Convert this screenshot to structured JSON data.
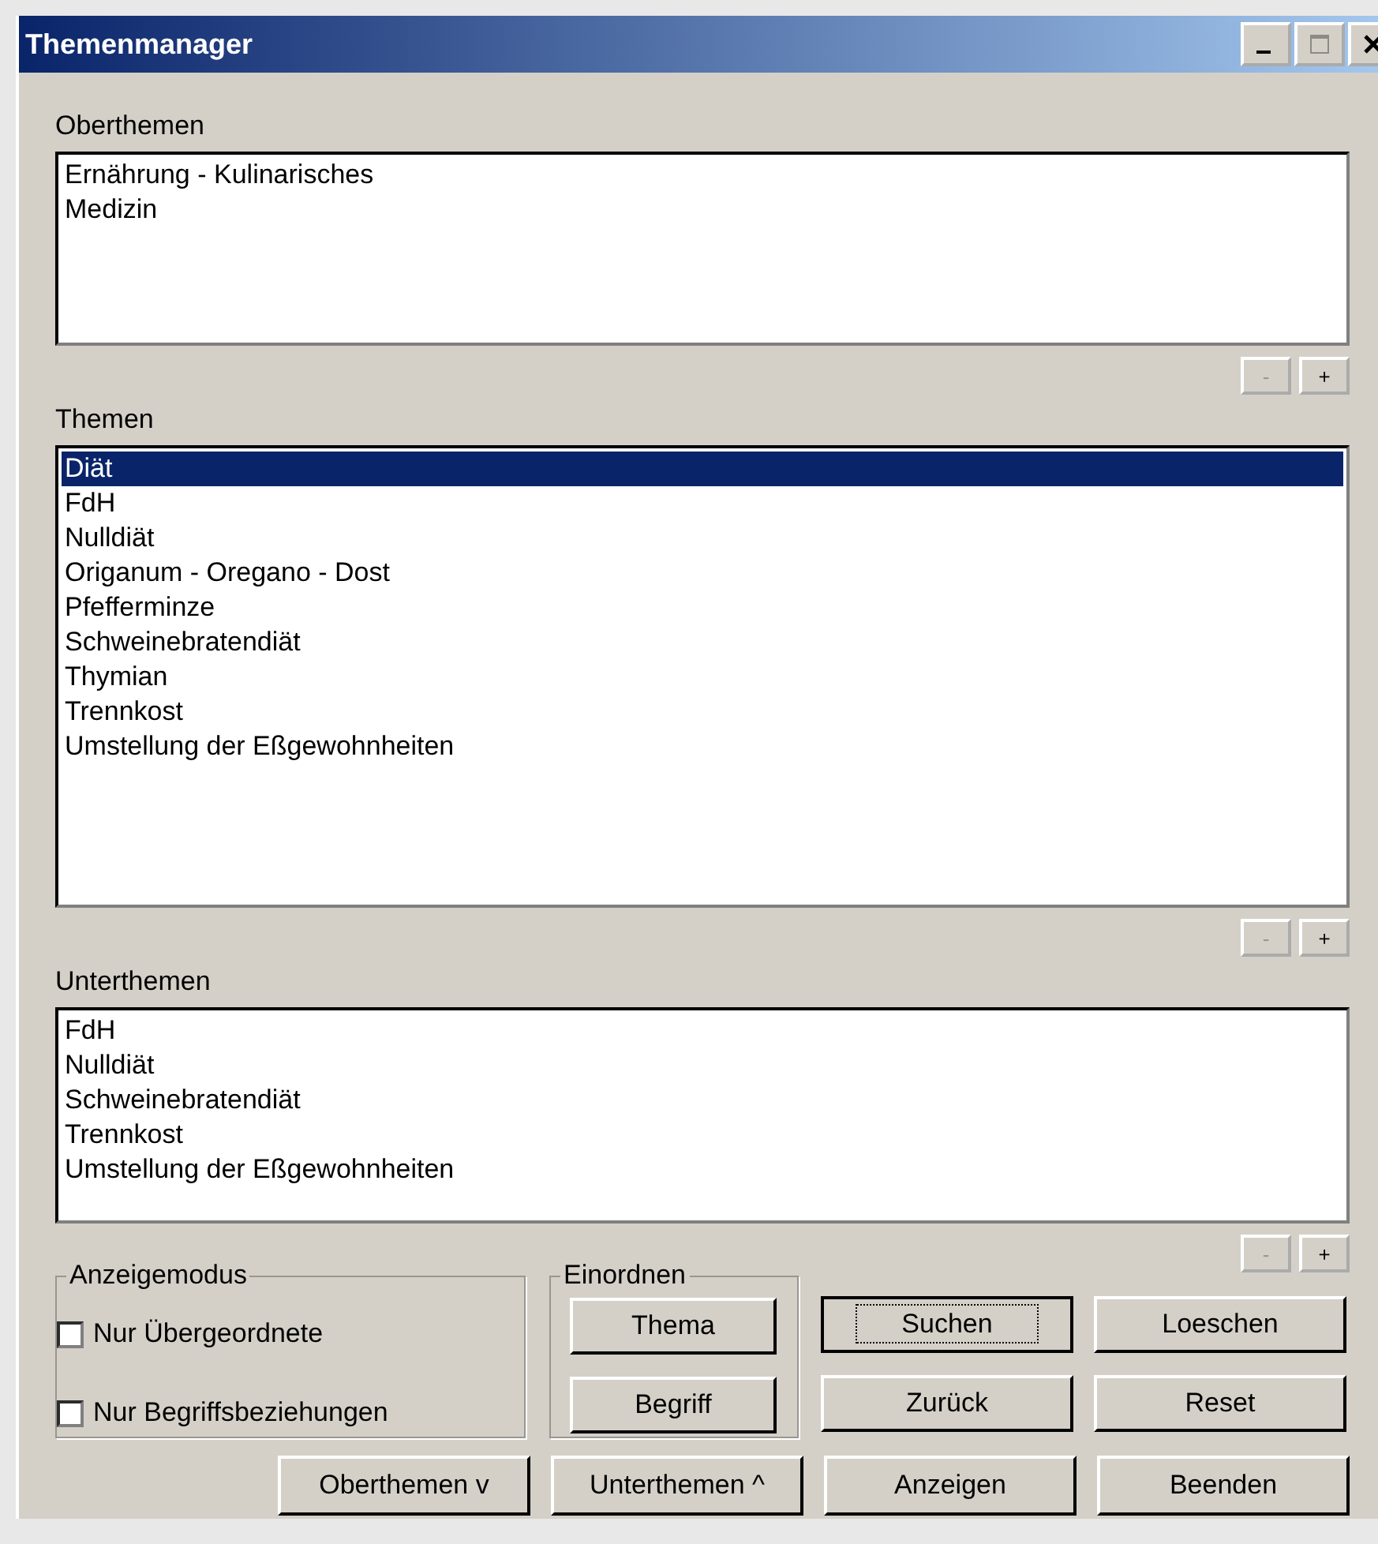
{
  "window": {
    "title": "Themenmanager"
  },
  "lists": [
    {
      "label": "Oberthemen",
      "items": [
        {
          "text": "Ernährung - Kulinarisches",
          "selected": false
        },
        {
          "text": "Medizin",
          "selected": false
        }
      ],
      "minus": {
        "text": "-",
        "disabled": true
      },
      "plus": {
        "text": "+",
        "disabled": false
      }
    },
    {
      "label": "Themen",
      "items": [
        {
          "text": "Diät",
          "selected": true
        },
        {
          "text": "FdH",
          "selected": false
        },
        {
          "text": "Nulldiät",
          "selected": false
        },
        {
          "text": "Origanum - Oregano - Dost",
          "selected": false
        },
        {
          "text": "Pfefferminze",
          "selected": false
        },
        {
          "text": "Schweinebratendiät",
          "selected": false
        },
        {
          "text": "Thymian",
          "selected": false
        },
        {
          "text": "Trennkost",
          "selected": false
        },
        {
          "text": "Umstellung der Eßgewohnheiten",
          "selected": false
        }
      ],
      "minus": {
        "text": "-",
        "disabled": true
      },
      "plus": {
        "text": "+",
        "disabled": false
      }
    },
    {
      "label": "Unterthemen",
      "items": [
        {
          "text": "FdH",
          "selected": false
        },
        {
          "text": "Nulldiät",
          "selected": false
        },
        {
          "text": "Schweinebratendiät",
          "selected": false
        },
        {
          "text": "Trennkost",
          "selected": false
        },
        {
          "text": "Umstellung der Eßgewohnheiten",
          "selected": false
        }
      ],
      "minus": {
        "text": "-",
        "disabled": true
      },
      "plus": {
        "text": "+",
        "disabled": false
      }
    }
  ],
  "anzeigemodus": {
    "title": "Anzeigemodus",
    "options": [
      {
        "label": "Nur Übergeordnete",
        "checked": false
      },
      {
        "label": "Nur Begriffsbeziehungen",
        "checked": false
      }
    ]
  },
  "einordnen": {
    "title": "Einordnen",
    "buttons": [
      "Thema",
      "Begriff"
    ]
  },
  "action_buttons": [
    {
      "label": "Suchen",
      "focused": true
    },
    {
      "label": "Loeschen",
      "focused": false
    },
    {
      "label": "Zurück",
      "focused": false
    },
    {
      "label": "Reset",
      "focused": false
    }
  ],
  "bottom_buttons": [
    {
      "label": "Oberthemen v",
      "focused": false
    },
    {
      "label": "Unterthemen ^",
      "focused": false
    },
    {
      "label": "Anzeigen",
      "focused": false
    },
    {
      "label": "Beenden",
      "focused": false
    }
  ]
}
